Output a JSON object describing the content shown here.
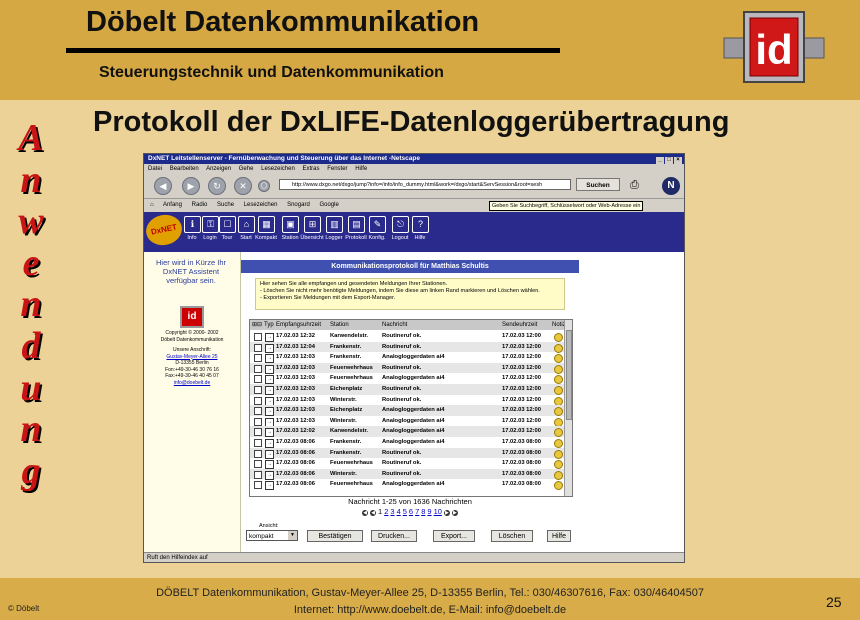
{
  "header": {
    "company": "Döbelt Datenkommunikation",
    "subtitle": "Steuerungstechnik und Datenkommunikation",
    "logo_text": "id"
  },
  "slide": {
    "title": "Protokoll der DxLIFE-Datenloggerübertragung",
    "vertical_letters": [
      "A",
      "n",
      "w",
      "e",
      "n",
      "d",
      "u",
      "n",
      "g"
    ],
    "page_number": "25"
  },
  "footer": {
    "line1": "DÖBELT Datenkommunikation, Gustav-Meyer-Allee 25, D-13355 Berlin, Tel.: 030/46307616, Fax: 030/46404507",
    "line2": "Internet: http://www.doebelt.de, E-Mail: info@doebelt.de",
    "copyright": "© Döbelt"
  },
  "browser": {
    "title": "DxNET Leitstellenserver - Fernüberwachung und Steuerung über das Internet -Netscape",
    "menu": [
      "Datei",
      "Bearbeiten",
      "Anzeigen",
      "Gehe",
      "Lesezeichen",
      "Extras",
      "Fenster",
      "Hilfe"
    ],
    "url": "http://www.dxgo.net/dxgo/jump?info=/info/info_dummy.html&work=/dxgo/start&ServSession&root=sesh",
    "search_button": "Suchen",
    "personal": [
      "Anfang",
      "Radio",
      "Suche",
      "Lesezeichen",
      "Snogard",
      "Google"
    ],
    "tooltip": "Geben Sie Suchbegriff, Schlüsselwort oder Web-Adresse ein",
    "status": "Ruft den Hilfeindex auf"
  },
  "dxnet": {
    "logo": "DxNET",
    "nav": [
      "Info",
      "Login",
      "Tour",
      "Start",
      "Kompakt",
      "Station",
      "Übersicht",
      "Logger",
      "Protokoll",
      "Konfig.",
      "Logout",
      "Hilfe"
    ],
    "assistant": "Hier wird in Kürze Ihr DxNET Assistent verfügbar sein.",
    "sidebar_logo": "id",
    "copyright": "Copyright © 2000- 2002",
    "company": "Döbelt Datenkommunikation",
    "address_label": "Unsere Anschrift:",
    "street": "Gustav-Meyer-Allee 25",
    "city": "D-13355 Berlin",
    "phone": "Fon:+49-30-46 30 76 16",
    "fax": "Fax:+49-30-46 40 45 07",
    "email": "info@doebelt.de"
  },
  "panel": {
    "title": "Kommunikationsprotokoll für Matthias Schultis",
    "info": [
      "Hier sehen Sie alle empfangen und gesendeten Meldungen Ihrer Stationen.",
      "- Löschen Sie nicht mehr benötigte Meldungen, indem Sie diese am linken Rand markieren und Löschen wählen.",
      "- Exportieren Sie Meldungen mit dem Export-Manager."
    ],
    "columns": [
      "Typ",
      "Empfangsuhrzeit",
      "Station",
      "Nachricht",
      "Sendeuhrzeit",
      "Notiz"
    ],
    "rows": [
      [
        "17.02.03 12:32",
        "Karwendelstr.",
        "Routineruf ok.",
        "17.02.03 12:00"
      ],
      [
        "17.02.03 12:04",
        "Frankenstr.",
        "Routineruf ok.",
        "17.02.03 12:00"
      ],
      [
        "17.02.03 12:03",
        "Frankenstr.",
        "Analogloggerdaten ai4",
        "17.02.03 12:00"
      ],
      [
        "17.02.03 12:03",
        "Feuerwehrhaus",
        "Routineruf ok.",
        "17.02.03 12:00"
      ],
      [
        "17.02.03 12:03",
        "Feuerwehrhaus",
        "Analogloggerdaten ai4",
        "17.02.03 12:00"
      ],
      [
        "17.02.03 12:03",
        "Eichenplatz",
        "Routineruf ok.",
        "17.02.03 12:00"
      ],
      [
        "17.02.03 12:03",
        "Winterstr.",
        "Routineruf ok.",
        "17.02.03 12:00"
      ],
      [
        "17.02.03 12:03",
        "Eichenplatz",
        "Analogloggerdaten ai4",
        "17.02.03 12:00"
      ],
      [
        "17.02.03 12:03",
        "Winterstr.",
        "Analogloggerdaten ai4",
        "17.02.03 12:00"
      ],
      [
        "17.02.03 12:02",
        "Karwendelstr.",
        "Analogloggerdaten ai4",
        "17.02.03 12:00"
      ],
      [
        "17.02.03 08:06",
        "Frankenstr.",
        "Analogloggerdaten ai4",
        "17.02.03 08:00"
      ],
      [
        "17.02.03 08:06",
        "Frankenstr.",
        "Routineruf ok.",
        "17.02.03 08:00"
      ],
      [
        "17.02.03 08:06",
        "Feuerwehrhaus",
        "Routineruf ok.",
        "17.02.03 08:00"
      ],
      [
        "17.02.03 08:06",
        "Winterstr.",
        "Routineruf ok.",
        "17.02.03 08:00"
      ],
      [
        "17.02.03 08:06",
        "Feuerwehrhaus",
        "Analogloggerdaten ai4",
        "17.02.03 08:00"
      ]
    ],
    "pager_info": "Nachricht 1-25 von 1636 Nachrichten",
    "pages": [
      "1",
      "2",
      "3",
      "4",
      "5",
      "6",
      "7",
      "8",
      "9",
      "10"
    ],
    "view_label": "Ansicht:",
    "view_value": "kompakt",
    "buttons": [
      "Bestätigen",
      "Drucken...",
      "Export...",
      "Löschen",
      "Hilfe"
    ]
  }
}
